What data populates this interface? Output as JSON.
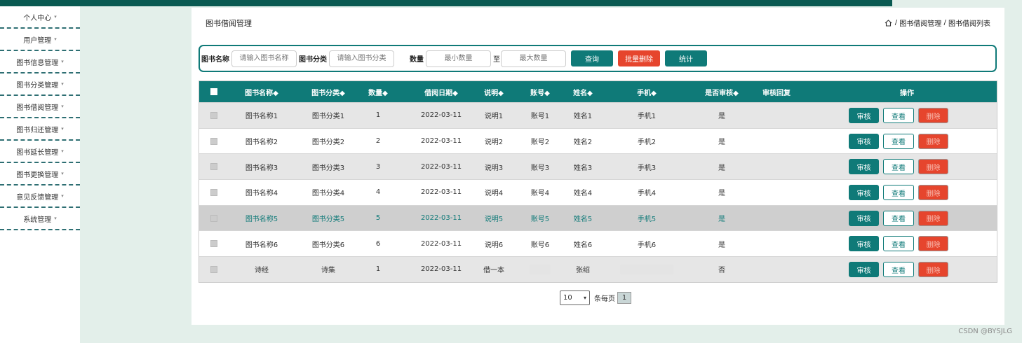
{
  "sidebar": {
    "items": [
      {
        "label": "个人中心"
      },
      {
        "label": "用户管理"
      },
      {
        "label": "图书信息管理"
      },
      {
        "label": "图书分类管理"
      },
      {
        "label": "图书借阅管理"
      },
      {
        "label": "图书归还管理"
      },
      {
        "label": "图书延长管理"
      },
      {
        "label": "图书更换管理"
      },
      {
        "label": "意见反馈管理"
      },
      {
        "label": "系统管理"
      }
    ],
    "caret": "▾"
  },
  "header": {
    "title": "图书借阅管理",
    "breadcrumb": {
      "sep": "/",
      "level1": "图书借阅管理",
      "level2": "图书借阅列表"
    }
  },
  "search": {
    "name_label": "图书名称",
    "name_placeholder": "请输入图书名称",
    "category_label": "图书分类",
    "category_placeholder": "请输入图书分类",
    "qty_label": "数量",
    "min_placeholder": "最小数量",
    "to_label": "至",
    "max_placeholder": "最大数量",
    "query_label": "查询",
    "batch_delete_label": "批量删除",
    "stats_label": "统计"
  },
  "table": {
    "columns": [
      "图书名称◆",
      "图书分类◆",
      "数量◆",
      "借阅日期◆",
      "说明◆",
      "账号◆",
      "姓名◆",
      "手机◆",
      "是否审核◆",
      "审核回复",
      "操作"
    ],
    "actions": {
      "audit": "审核",
      "view": "查看",
      "delete": "删除"
    },
    "rows": [
      {
        "name": "图书名称1",
        "category": "图书分类1",
        "qty": "1",
        "date": "2022-03-11",
        "note": "说明1",
        "account": "账号1",
        "person": "姓名1",
        "phone": "手机1",
        "audited": "是",
        "reply": ""
      },
      {
        "name": "图书名称2",
        "category": "图书分类2",
        "qty": "2",
        "date": "2022-03-11",
        "note": "说明2",
        "account": "账号2",
        "person": "姓名2",
        "phone": "手机2",
        "audited": "是",
        "reply": ""
      },
      {
        "name": "图书名称3",
        "category": "图书分类3",
        "qty": "3",
        "date": "2022-03-11",
        "note": "说明3",
        "account": "账号3",
        "person": "姓名3",
        "phone": "手机3",
        "audited": "是",
        "reply": ""
      },
      {
        "name": "图书名称4",
        "category": "图书分类4",
        "qty": "4",
        "date": "2022-03-11",
        "note": "说明4",
        "account": "账号4",
        "person": "姓名4",
        "phone": "手机4",
        "audited": "是",
        "reply": ""
      },
      {
        "name": "图书名称5",
        "category": "图书分类5",
        "qty": "5",
        "date": "2022-03-11",
        "note": "说明5",
        "account": "账号5",
        "person": "姓名5",
        "phone": "手机5",
        "audited": "是",
        "reply": ""
      },
      {
        "name": "图书名称6",
        "category": "图书分类6",
        "qty": "6",
        "date": "2022-03-11",
        "note": "说明6",
        "account": "账号6",
        "person": "姓名6",
        "phone": "手机6",
        "audited": "是",
        "reply": ""
      },
      {
        "name": "诗经",
        "category": "诗集",
        "qty": "1",
        "date": "2022-03-11",
        "note": "借一本",
        "account": "",
        "person": "张绍",
        "phone": "",
        "audited": "否",
        "reply": ""
      }
    ]
  },
  "pager": {
    "page_size": "10",
    "arrow": "▾",
    "per_page_label": "条每页",
    "current_page": "1"
  },
  "watermark": "CSDN @BYSJLG",
  "colors": {
    "accent": "#0f7a78",
    "danger": "#e6452d",
    "highlight_row": "#cfcfcf",
    "topbar": "#0a5a52"
  }
}
